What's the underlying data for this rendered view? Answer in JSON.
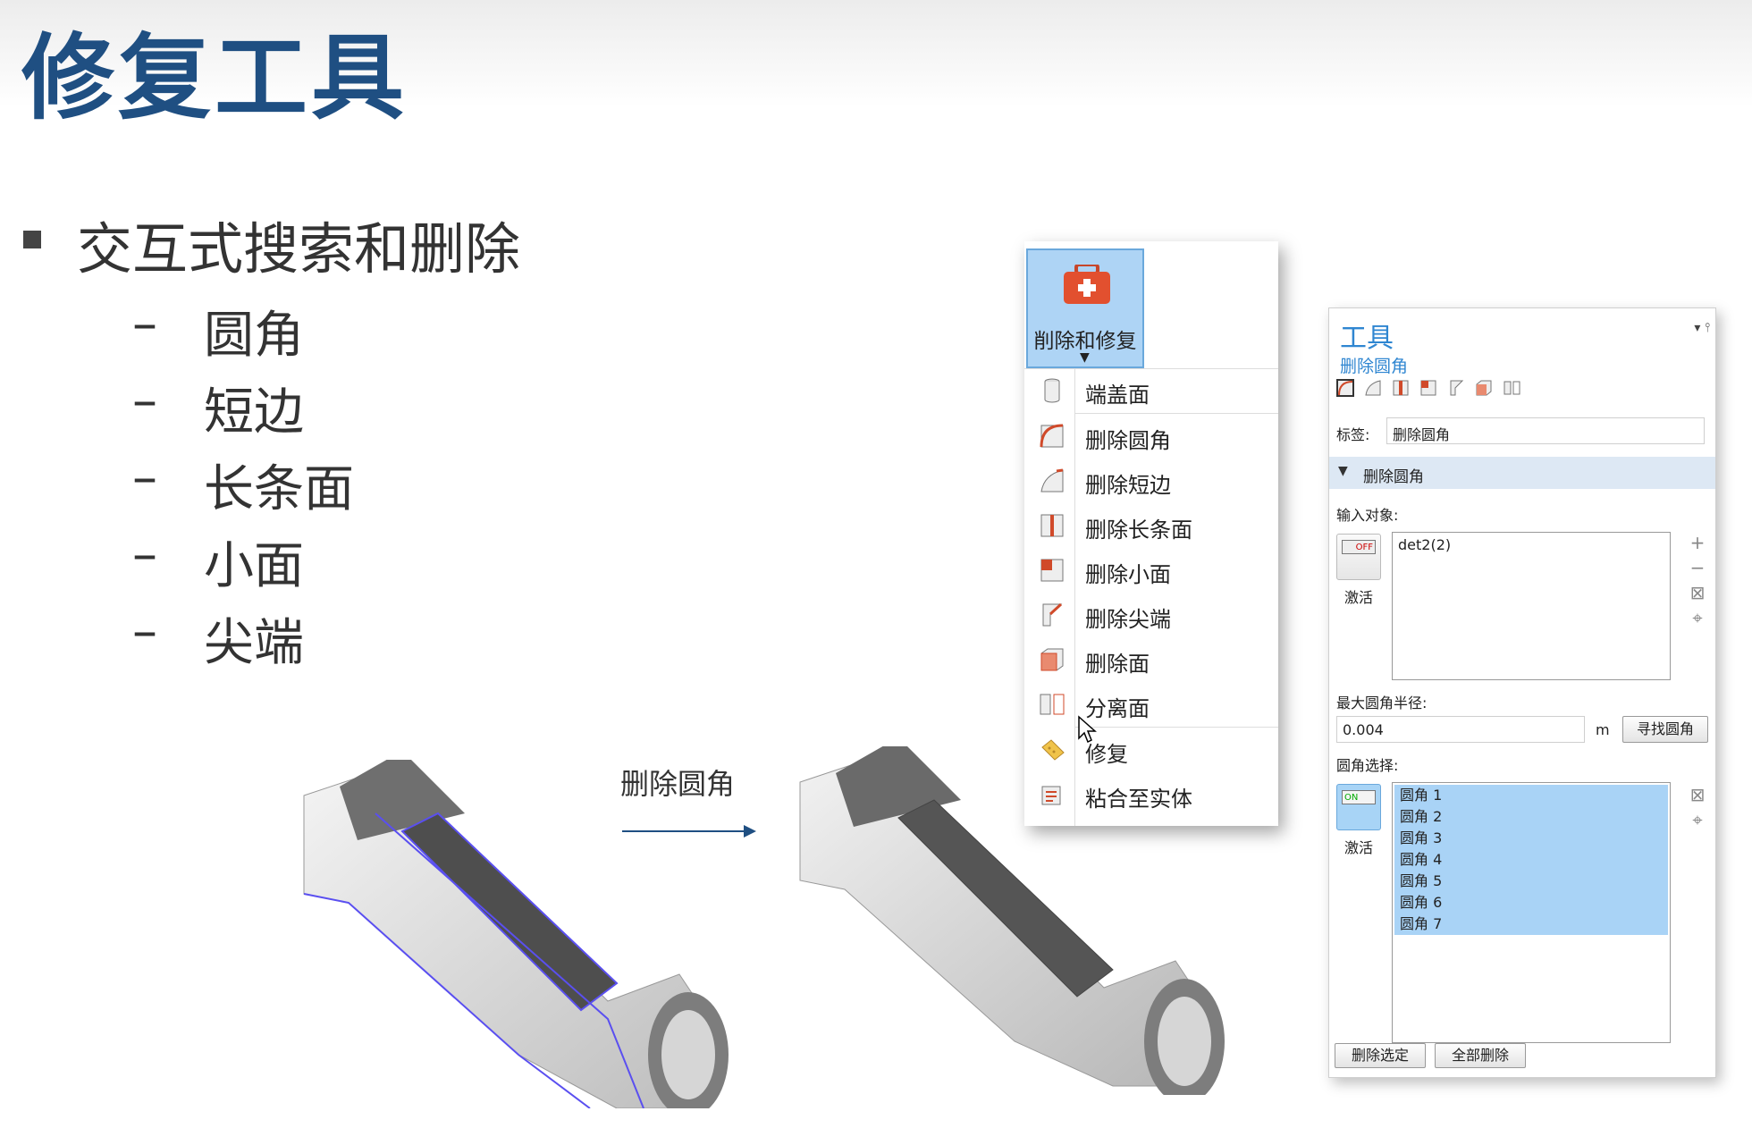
{
  "slide": {
    "title": "修复工具",
    "bullet": "交互式搜索和删除",
    "dash": "–",
    "sub_items": [
      "圆角",
      "短边",
      "长条面",
      "小面",
      "尖端"
    ],
    "arrow_label": "删除圆角"
  },
  "menu": {
    "button_label": "削除和修复",
    "items": [
      {
        "label": "端盖面",
        "icon": "cylinder-icon"
      },
      {
        "label": "删除圆角",
        "icon": "delete-fillet-icon"
      },
      {
        "label": "删除短边",
        "icon": "delete-short-edge-icon"
      },
      {
        "label": "删除长条面",
        "icon": "delete-sliver-face-icon"
      },
      {
        "label": "删除小面",
        "icon": "delete-small-face-icon"
      },
      {
        "label": "删除尖端",
        "icon": "delete-spike-icon"
      },
      {
        "label": "删除面",
        "icon": "delete-face-icon"
      },
      {
        "label": "分离面",
        "icon": "detach-face-icon"
      },
      {
        "label": "修复",
        "icon": "repair-icon"
      },
      {
        "label": "粘合至实体",
        "icon": "knit-to-solid-icon"
      }
    ]
  },
  "panel": {
    "title": "工具",
    "subtitle": "删除圆角",
    "label_caption": "标签:",
    "label_value": "删除圆角",
    "section": "删除圆角",
    "input_objects_label": "输入对象:",
    "input_objects": [
      "det2(2)"
    ],
    "activate_label": "激活",
    "off_badge": "OFF",
    "on_badge": "ON",
    "max_radius_label": "最大圆角半径:",
    "max_radius_value": "0.004",
    "unit": "m",
    "find_button": "寻找圆角",
    "fillet_selection_label": "圆角选择:",
    "fillets": [
      "圆角 1",
      "圆角 2",
      "圆角 3",
      "圆角 4",
      "圆角 5",
      "圆角 6",
      "圆角 7"
    ],
    "delete_selected": "删除选定",
    "delete_all": "全部删除"
  }
}
